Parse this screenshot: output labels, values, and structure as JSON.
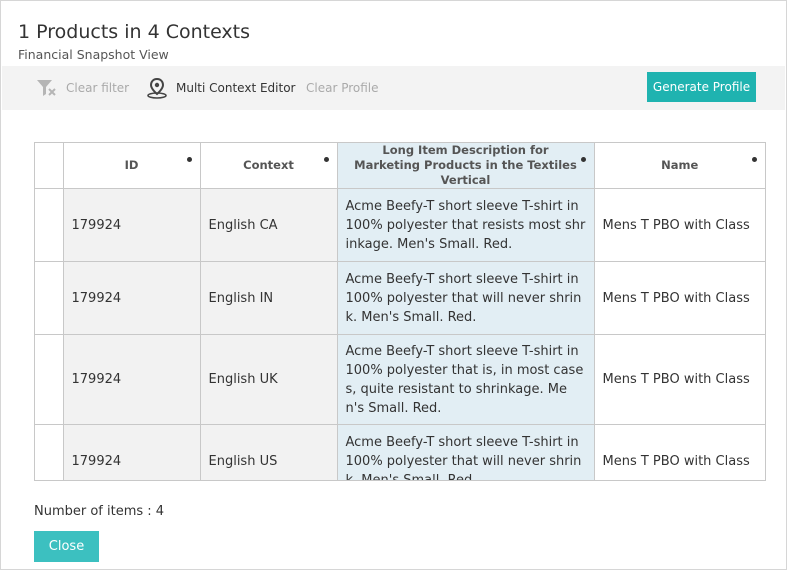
{
  "dialog": {
    "title": "1 Products in 4 Contexts",
    "subtitle": "Financial Snapshot View"
  },
  "toolbar": {
    "clear_filter": {
      "label": "Clear filter",
      "icon": "filter-clear-icon",
      "enabled": false
    },
    "multi_context_editor": {
      "label": "Multi Context Editor",
      "icon": "map-pin-icon",
      "enabled": true
    },
    "clear_profile": {
      "label": "Clear Profile",
      "enabled": false
    },
    "generate_profile": {
      "label": "Generate Profile"
    }
  },
  "table": {
    "columns": {
      "id": "ID",
      "context": "Context",
      "description": "Long Item Description for Marketing Products in the Textiles Vertical",
      "name": "Name"
    },
    "rows": [
      {
        "id": "179924",
        "context": "English CA",
        "description": "Acme Beefy-T short sleeve T-shirt in 100% polyester that resists most shrinkage. Men's Small. Red.",
        "name": "Mens T PBO with Class"
      },
      {
        "id": "179924",
        "context": "English IN",
        "description": "Acme Beefy-T short sleeve T-shirt in 100% polyester that will never shrink. Men's Small. Red.",
        "name": "Mens T PBO with Class"
      },
      {
        "id": "179924",
        "context": "English UK",
        "description": "Acme Beefy-T short sleeve T-shirt in 100% polyester that is, in most cases, quite resistant to shrinkage. Men's Small. Red.",
        "name": "Mens T PBO with Class"
      },
      {
        "id": "179924",
        "context": "English US",
        "description": "Acme Beefy-T short sleeve T-shirt in 100% polyester that will never shrink. Men's Small. Red.",
        "name": "Mens T PBO with Class"
      }
    ]
  },
  "footer": {
    "item_count": "Number of items : 4",
    "close_label": "Close"
  },
  "colors": {
    "accent": "#1fb3b0",
    "highlight_column": "#e2eef4",
    "toolbar_bg": "#f3f3f3"
  }
}
